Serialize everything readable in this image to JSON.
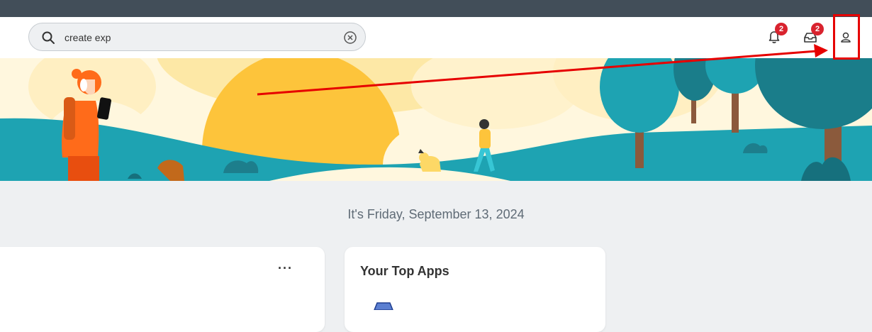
{
  "search": {
    "value": "create exp",
    "icon": "search-icon",
    "clear_icon": "clear-icon"
  },
  "header": {
    "notifications": {
      "icon": "bell-icon",
      "count": "2"
    },
    "inbox": {
      "icon": "inbox-icon",
      "count": "2"
    },
    "profile": {
      "icon": "user-icon"
    }
  },
  "date_text": "It's Friday, September 13, 2024",
  "cards": {
    "left": {
      "more_label": "···"
    },
    "top_apps": {
      "title": "Your Top Apps"
    }
  },
  "colors": {
    "topbar": "#424e59",
    "badge": "#d9232e",
    "annotation": "#e60000",
    "teal": "#1ea3b2",
    "sun": "#fdc43b"
  }
}
